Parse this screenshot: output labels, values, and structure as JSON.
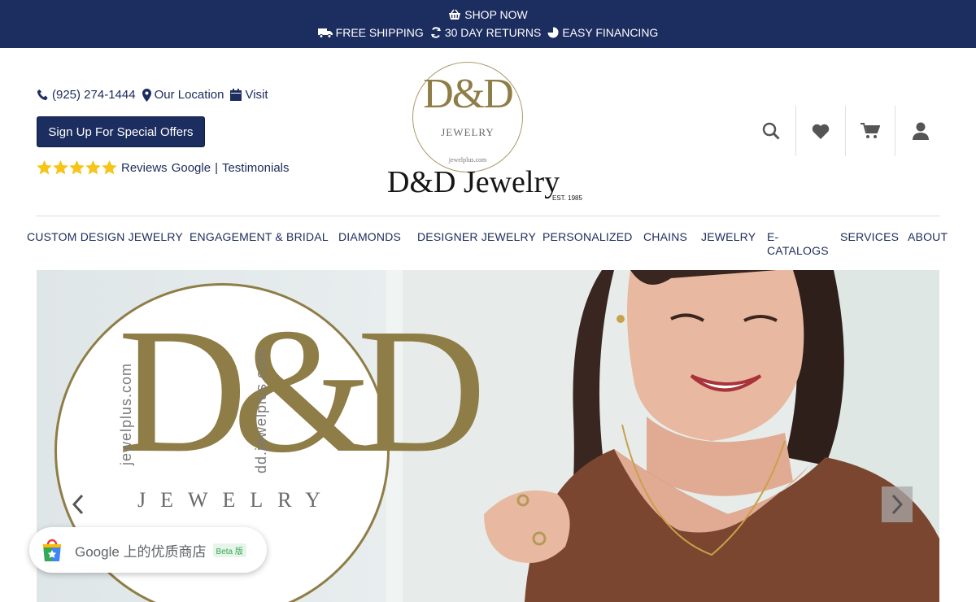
{
  "top_banner": {
    "shop_now": "SHOP NOW",
    "promos": [
      {
        "icon": "truck-icon",
        "label": "FREE SHIPPING"
      },
      {
        "icon": "refresh-icon",
        "label": "30 DAY RETURNS"
      },
      {
        "icon": "pie-chart-icon",
        "label": "EASY FINANCING"
      }
    ]
  },
  "header": {
    "phone": "(925) 274-1444",
    "location": "Our Location",
    "visit": "Visit",
    "signup_button": "Sign Up For Special Offers",
    "reviews_label": "Reviews",
    "reviews_google": "Google",
    "reviews_separator": "|",
    "reviews_testimonials": "Testimonials",
    "star_count": 5
  },
  "logo": {
    "monogram": "D&D",
    "subtitle": "JEWELRY",
    "url": "jewelplus.com",
    "name": "D&D Jewelry",
    "est": "EST. 1985"
  },
  "header_icons": [
    "search-icon",
    "heart-icon",
    "cart-icon",
    "user-icon"
  ],
  "nav": [
    "CUSTOM DESIGN JEWELRY",
    "ENGAGEMENT & BRIDAL",
    "DIAMONDS",
    "DESIGNER JEWELRY",
    "PERSONALIZED",
    "CHAINS",
    "JEWELRY",
    "E-CATALOGS",
    "SERVICES",
    "ABOUT"
  ],
  "hero": {
    "monogram": "D&D",
    "subtitle": "JEWELRY",
    "url_left": "jewelplus.com",
    "url_right": "dd.jewelplus.com"
  },
  "google_badge": {
    "text": "Google 上的优质商店",
    "beta": "Beta 版"
  },
  "colors": {
    "navy": "#1c2d5f",
    "gold": "#8f7d47",
    "star": "#f5c518"
  }
}
